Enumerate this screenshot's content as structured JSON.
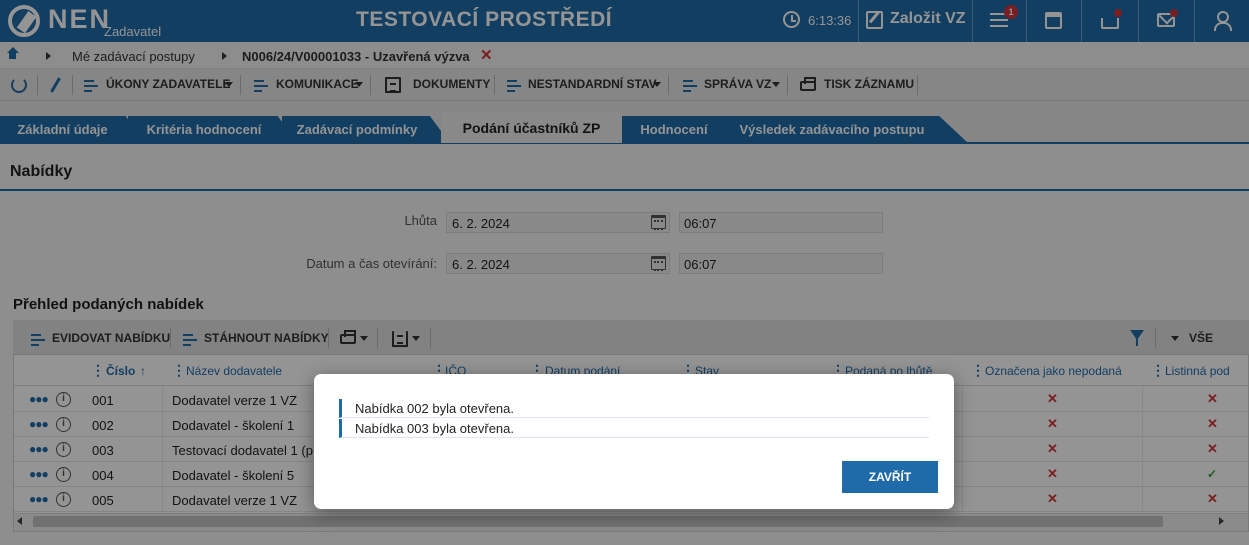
{
  "header": {
    "logo_text": "NEN",
    "logo_sub": "Zadavatel",
    "app_title": "TESTOVACÍ PROSTŘEDÍ",
    "time": "6:13:36",
    "new_vz_label": "Založit VZ",
    "notifications_count": "1"
  },
  "breadcrumb": {
    "items": [
      "Mé zadávací postupy",
      "N006/24/V00001033 - Uzavřená výzva"
    ],
    "close_glyph": "✕"
  },
  "toolbar": {
    "items": [
      "ÚKONY ZADAVATELE",
      "KOMUNIKACE",
      "DOKUMENTY",
      "NESTANDARDNÍ STAV",
      "SPRÁVA VZ",
      "TISK ZÁZNAMU"
    ]
  },
  "tabs": [
    {
      "label": "Základní údaje",
      "active": false
    },
    {
      "label": "Kritéria hodnocení",
      "active": false
    },
    {
      "label": "Zadávací podmínky",
      "active": false
    },
    {
      "label": "Podání účastníků ZP",
      "active": true
    },
    {
      "label": "Hodnocení",
      "active": false
    },
    {
      "label": "Výsledek zadávacího postupu",
      "active": false
    }
  ],
  "section": {
    "title": "Nabídky",
    "deadline_label": "Lhůta",
    "deadline_date": "6. 2. 2024",
    "deadline_time": "06:07",
    "opening_label": "Datum a čas otevírání:",
    "opening_date": "6. 2. 2024",
    "opening_time": "06:07",
    "overview_title": "Přehled podaných nabídek"
  },
  "grid": {
    "toolbar": {
      "register": "EVIDOVAT NABÍDKU",
      "download": "STÁHNOUT NABÍDKY",
      "view_all": "VŠE"
    },
    "columns": [
      "Číslo",
      "Název dodavatele",
      "IČO",
      "Datum podání",
      "Stav",
      "Podaná po lhůtě",
      "Označena jako nepodaná",
      "Listinná pod"
    ],
    "sort_glyph": "↑",
    "rows": [
      {
        "number": "001",
        "supplier": "Dodavatel verze 1 VZ",
        "marked_unsubmitted": "✕",
        "paper": "✕"
      },
      {
        "number": "002",
        "supplier": "Dodavatel - školení 1",
        "marked_unsubmitted": "✕",
        "paper": "✕"
      },
      {
        "number": "003",
        "supplier": "Testovací dodavatel 1 (p",
        "marked_unsubmitted": "✕",
        "paper": "✕"
      },
      {
        "number": "004",
        "supplier": "Dodavatel - školení 5",
        "marked_unsubmitted": "✕",
        "paper": "✓"
      },
      {
        "number": "005",
        "supplier": "Dodavatel verze 1 VZ",
        "marked_unsubmitted": "✕",
        "paper": "✕"
      }
    ]
  },
  "modal": {
    "messages": [
      "Nabídka 002 byla otevřena.",
      "Nabídka 003 byla otevřena."
    ],
    "close_label": "ZAVŘÍT"
  },
  "colors": {
    "brand": "#1f6ba9",
    "error": "#d0343a",
    "success": "#2e9d3c"
  },
  "icons": [
    "logo-icon",
    "clock-icon",
    "edit-icon",
    "menu-icon",
    "calendar-icon",
    "inbox-icon",
    "mail-icon",
    "user-icon",
    "home-icon",
    "refresh-icon",
    "pencil-icon",
    "document-icon",
    "print-icon",
    "filter-icon",
    "info-icon",
    "more-icon"
  ]
}
